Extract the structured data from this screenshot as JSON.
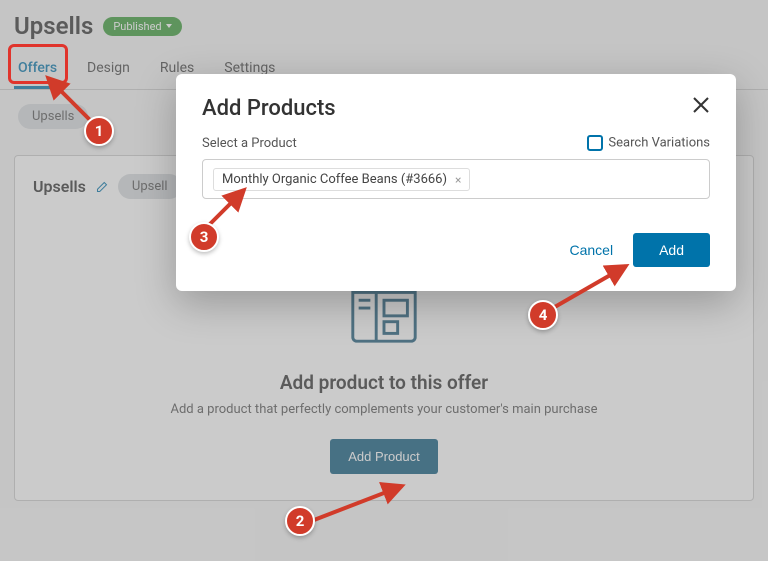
{
  "header": {
    "title": "Upsells",
    "badge": "Published"
  },
  "tabs": [
    "Offers",
    "Design",
    "Rules",
    "Settings"
  ],
  "activeTab": 0,
  "chip": "Upsells",
  "card": {
    "title": "Upsells",
    "secondChip": "Upsell",
    "body": {
      "heading": "Add product to this offer",
      "sub": "Add a product that perfectly complements your customer's main purchase",
      "button": "Add Product"
    }
  },
  "modal": {
    "title": "Add Products",
    "selectLabel": "Select a Product",
    "variationsLabel": "Search Variations",
    "productChip": "Monthly Organic Coffee Beans (#3666)",
    "cancel": "Cancel",
    "add": "Add"
  },
  "callouts": [
    "1",
    "2",
    "3",
    "4"
  ]
}
